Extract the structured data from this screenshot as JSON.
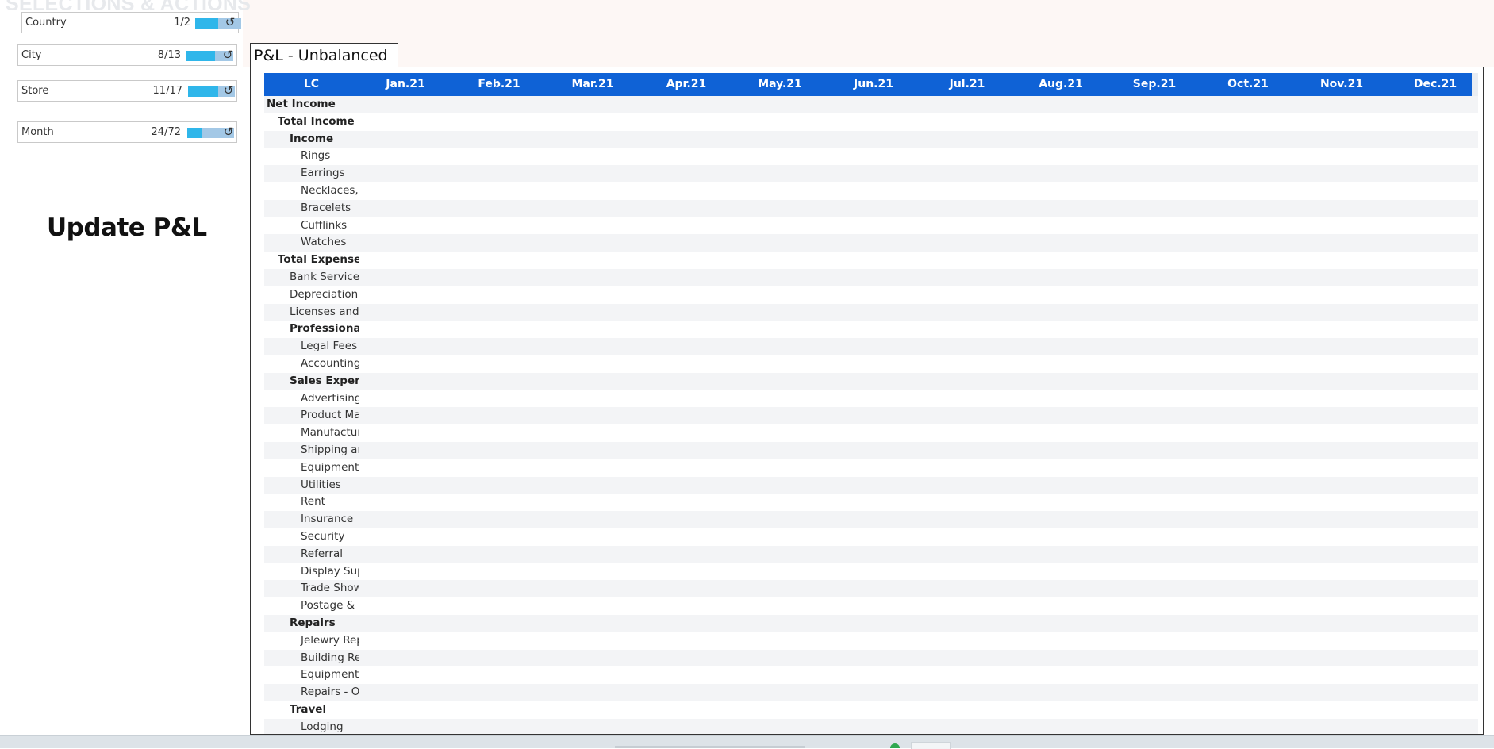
{
  "sidebar": {
    "ghost_title": "SELECTIONS & ACTIONS",
    "filters": [
      {
        "name": "Country",
        "count": "1/2",
        "fill": 0.5
      },
      {
        "name": "City",
        "count": "8/13",
        "fill": 0.62
      },
      {
        "name": "Store",
        "count": "11/17",
        "fill": 0.65
      },
      {
        "name": "Month",
        "count": "24/72",
        "fill": 0.33
      }
    ],
    "reset_icon": "↺",
    "update_title": "Update P&L"
  },
  "table": {
    "title": "P&L - Unbalanced",
    "lc_header": "LC",
    "months": [
      "Jan.21",
      "Feb.21",
      "Mar.21",
      "Apr.21",
      "May.21",
      "Jun.21",
      "Jul.21",
      "Aug.21",
      "Sep.21",
      "Oct.21",
      "Nov.21",
      "Dec.21"
    ],
    "rows": [
      {
        "label": "Net Income",
        "level": 0,
        "bold": true
      },
      {
        "label": "Total Income",
        "level": 1,
        "bold": true
      },
      {
        "label": "Income",
        "level": 2,
        "bold": true
      },
      {
        "label": "Rings",
        "level": 3,
        "bold": false
      },
      {
        "label": "Earrings",
        "level": 3,
        "bold": false
      },
      {
        "label": "Necklaces, (",
        "level": 3,
        "bold": false
      },
      {
        "label": "Bracelets",
        "level": 3,
        "bold": false
      },
      {
        "label": "Cufflinks",
        "level": 3,
        "bold": false
      },
      {
        "label": "Watches",
        "level": 3,
        "bold": false
      },
      {
        "label": "Total Expenses",
        "level": 1,
        "bold": true
      },
      {
        "label": "Bank Service (",
        "level": 2,
        "bold": false
      },
      {
        "label": "Depreciation",
        "level": 2,
        "bold": false
      },
      {
        "label": "Licenses and",
        "level": 2,
        "bold": false
      },
      {
        "label": "Professional F",
        "level": 2,
        "bold": true
      },
      {
        "label": "Legal Fees",
        "level": 3,
        "bold": false
      },
      {
        "label": "Accounting",
        "level": 3,
        "bold": false
      },
      {
        "label": "Sales Expense",
        "level": 2,
        "bold": true
      },
      {
        "label": "Advertising",
        "level": 3,
        "bold": false
      },
      {
        "label": "Product Ma",
        "level": 3,
        "bold": false
      },
      {
        "label": "Manufactur",
        "level": 3,
        "bold": false
      },
      {
        "label": "Shipping ar",
        "level": 3,
        "bold": false
      },
      {
        "label": "Equipment",
        "level": 3,
        "bold": false
      },
      {
        "label": "Utilities",
        "level": 3,
        "bold": false
      },
      {
        "label": "Rent",
        "level": 3,
        "bold": false
      },
      {
        "label": "Insurance",
        "level": 3,
        "bold": false
      },
      {
        "label": "Security",
        "level": 3,
        "bold": false
      },
      {
        "label": "Referral",
        "level": 3,
        "bold": false
      },
      {
        "label": "Display Sup",
        "level": 3,
        "bold": false
      },
      {
        "label": "Trade Show",
        "level": 3,
        "bold": false
      },
      {
        "label": "Postage & [",
        "level": 3,
        "bold": false
      },
      {
        "label": "Repairs",
        "level": 2,
        "bold": true
      },
      {
        "label": "Jelewry Rep",
        "level": 3,
        "bold": false
      },
      {
        "label": "Building Re",
        "level": 3,
        "bold": false
      },
      {
        "label": "Equipment",
        "level": 3,
        "bold": false
      },
      {
        "label": "Repairs - O",
        "level": 3,
        "bold": false
      },
      {
        "label": "Travel",
        "level": 2,
        "bold": true
      },
      {
        "label": "Lodging",
        "level": 3,
        "bold": false
      }
    ]
  }
}
